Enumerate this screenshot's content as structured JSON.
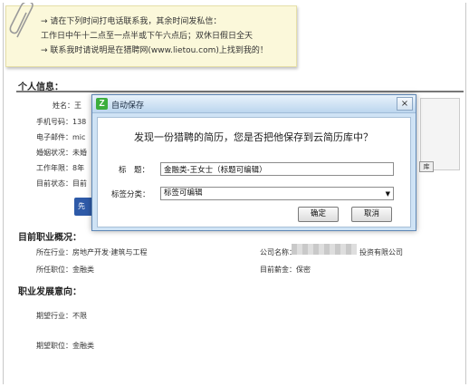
{
  "note": {
    "line1": "→ 请在下列时间打电话联系我，其余时间发私信：",
    "line2": "工作日中午十二点至一点半或下午六点后；双休日假日全天",
    "line3": "→ 联系我时请说明是在猎聘网(www.lietou.com)上找到我的！"
  },
  "personal": {
    "title": "个人信息：",
    "name": "姓名：王",
    "phone": "手机号码：138",
    "email": "电子邮件：mic",
    "marriage": "婚姻状况：未婚",
    "work_years": "工作年限：8年",
    "status": "目前状态：目前",
    "blue_button": "先",
    "side_button": "库"
  },
  "current_job": {
    "title": "目前职业概况：",
    "industry": "所在行业：房地产开发·建筑与工程",
    "position": "所任职位：金融类",
    "company_label": "公司名称：",
    "company_suffix": "投资有限公司",
    "salary": "目前薪金：保密"
  },
  "intent": {
    "title": "职业发展意向：",
    "expected_industry": "期望行业：不限",
    "expected_position": "期望职位：金融类"
  },
  "dialog": {
    "app_icon": "Z",
    "title": "自动保存",
    "close": "×",
    "question": "发现一份猎聘的简历，您是否把他保存到云简历库中？",
    "title_label": "标　题：",
    "title_value": "金融类-王女士（标题可编辑）",
    "tag_label": "标签分类：",
    "tag_value": "标签可编辑",
    "ok": "确定",
    "cancel": "取消"
  }
}
